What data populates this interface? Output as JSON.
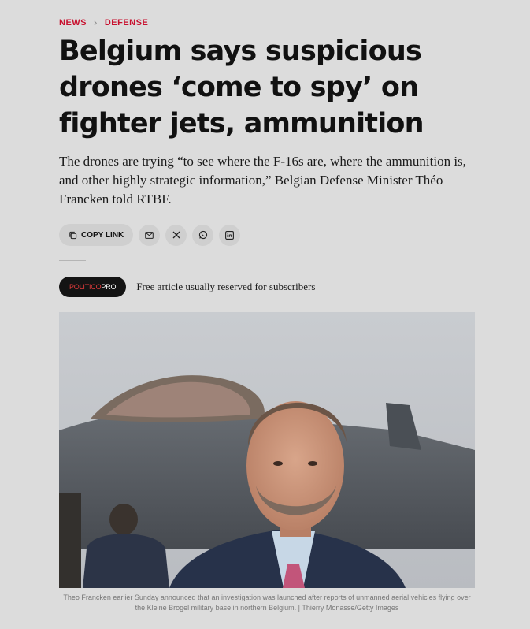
{
  "breadcrumb": {
    "items": [
      "NEWS",
      "DEFENSE"
    ],
    "separator": "›"
  },
  "headline": "Belgium says suspicious drones ‘come to spy’ on fighter jets, ammunition",
  "dek": "The drones are trying “to see where the F-16s are, where the ammunition is, and other highly strategic information,” Belgian Defense Minister Théo Francken told RTBF.",
  "share": {
    "copy_label": "COPY LINK",
    "icons": [
      "email-icon",
      "x-icon",
      "whatsapp-icon",
      "linkedin-icon"
    ]
  },
  "pro": {
    "badge_brand": "POLITICO",
    "badge_suffix": "PRO",
    "text": "Free article usually reserved for subscribers"
  },
  "photo": {
    "caption": "Theo Francken earlier Sunday announced that an investigation was launched after reports of unmanned aerial vehicles flying over the Kleine Brogel military base in northern Belgium. | Thierry Monasse/Getty Images"
  },
  "colors": {
    "accent": "#c8102e",
    "background": "#dcdcdc",
    "badge_bg": "#141414"
  }
}
